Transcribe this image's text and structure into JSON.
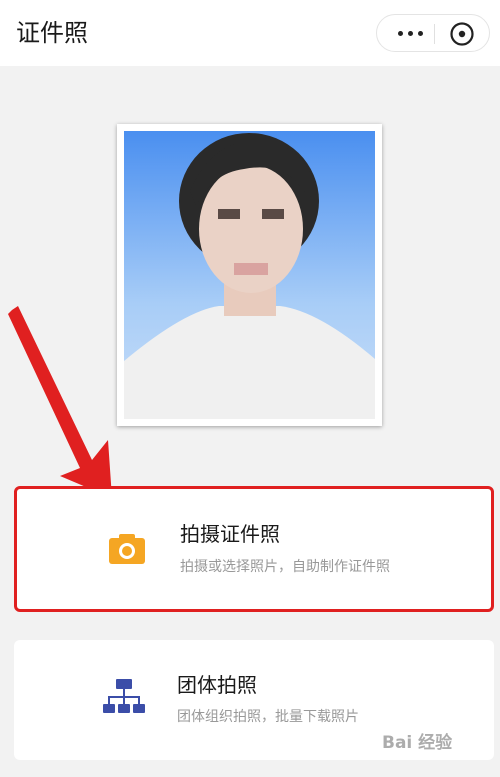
{
  "header": {
    "title": "证件照",
    "more_icon": "more-dots-icon",
    "close_icon": "mini-program-close-icon"
  },
  "photo": {
    "alt": "sample-id-photo",
    "background_color": "#4a8ff0"
  },
  "options": [
    {
      "name": "拍摄证件照",
      "description": "拍摄或选择照片，自助制作证件照",
      "icon": "camera-icon",
      "icon_color": "#f5a623",
      "highlighted": true
    },
    {
      "name": "团体拍照",
      "description": "团体组织拍照，批量下载照片",
      "icon": "org-chart-icon",
      "icon_color": "#3b4da8",
      "highlighted": false
    }
  ],
  "annotation": {
    "arrow_color": "#e02020",
    "highlight_color": "#e02020"
  },
  "watermark": {
    "text": "Bai 经验"
  }
}
